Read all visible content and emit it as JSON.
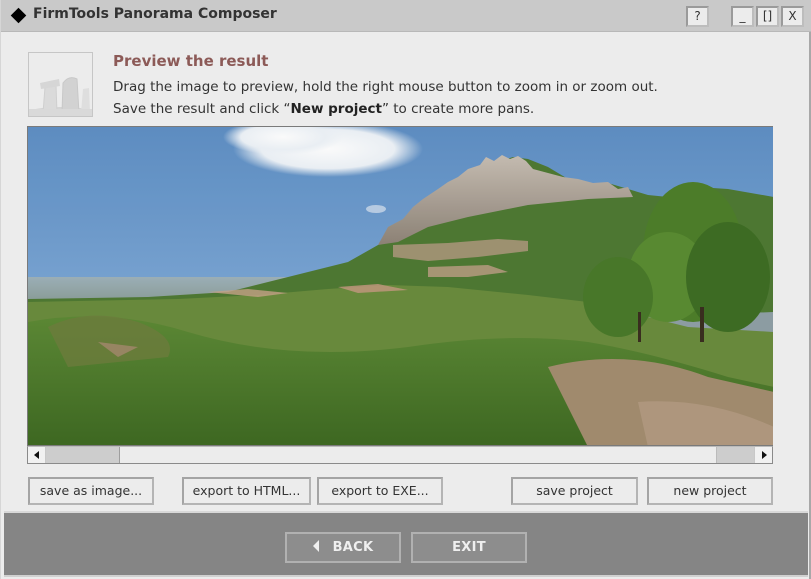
{
  "window": {
    "title": "FirmTools Panorama Composer",
    "app_icon": "diamond-icon",
    "controls": {
      "help_label": "?",
      "minimize_label": "_",
      "maximize_label": "[]",
      "close_label": "X"
    }
  },
  "header": {
    "icon": "stonehenge-icon",
    "title": "Preview the result",
    "line1": "Drag the image to preview, hold the right mouse button to zoom in or zoom out.",
    "line2_prefix": "Save the result and click “",
    "line2_bold": "New project",
    "line2_suffix": "” to create more pans."
  },
  "preview": {
    "content": "panorama-image",
    "description": "Mountain panorama with rocky peaks, blue sky with cloud, green hills and a tree",
    "scroll_position_fraction": 0.0
  },
  "actions": {
    "save_as_image": "save as image...",
    "export_html": "export to HTML...",
    "export_exe": "export to EXE...",
    "save_project": "save project",
    "new_project": "new project"
  },
  "footer": {
    "back_label": "BACK",
    "exit_label": "EXIT"
  },
  "colors": {
    "title_accent": "#8c5a57",
    "footer_bg": "#858585",
    "titlebar_bg": "#c9c9c9"
  }
}
